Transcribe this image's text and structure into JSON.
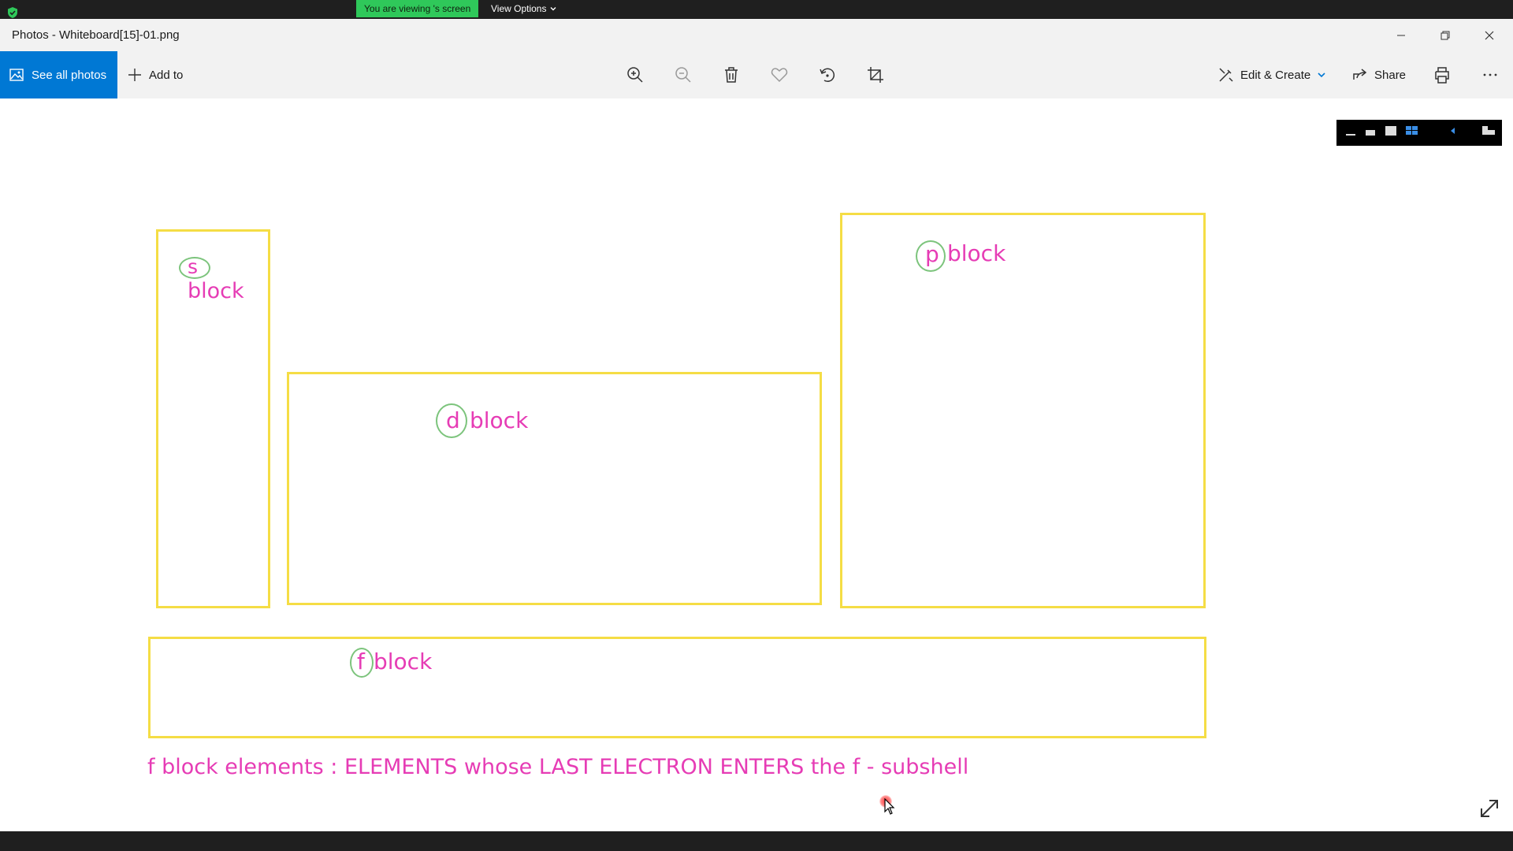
{
  "screen_share": {
    "viewing_text": "You are viewing 's screen",
    "view_options_label": "View Options"
  },
  "window": {
    "title": "Photos - Whiteboard[15]-01.png"
  },
  "toolbar": {
    "see_all_photos": "See all photos",
    "add_to": "Add to",
    "edit_create": "Edit & Create",
    "share": "Share",
    "icons": [
      "zoom-in-icon",
      "zoom-out-icon",
      "delete-icon",
      "favorite-heart-icon",
      "rotate-icon",
      "crop-icon",
      "print-icon",
      "more-icon"
    ]
  },
  "whiteboard": {
    "s_letter": "s",
    "s_label": "block",
    "d_letter": "d",
    "d_label": "block",
    "p_letter": "p",
    "p_label": "block",
    "f_letter": "f",
    "f_label": "block",
    "caption": "f block elements : ELEMENTS whose LAST ELECTRON ENTERS the f - subshell",
    "colors": {
      "box_border": "#f5dd45",
      "text": "#e63cb5",
      "circle": "#7cc47c"
    }
  },
  "colors": {
    "accent": "#0078d4",
    "share_green": "#2fc85a"
  }
}
